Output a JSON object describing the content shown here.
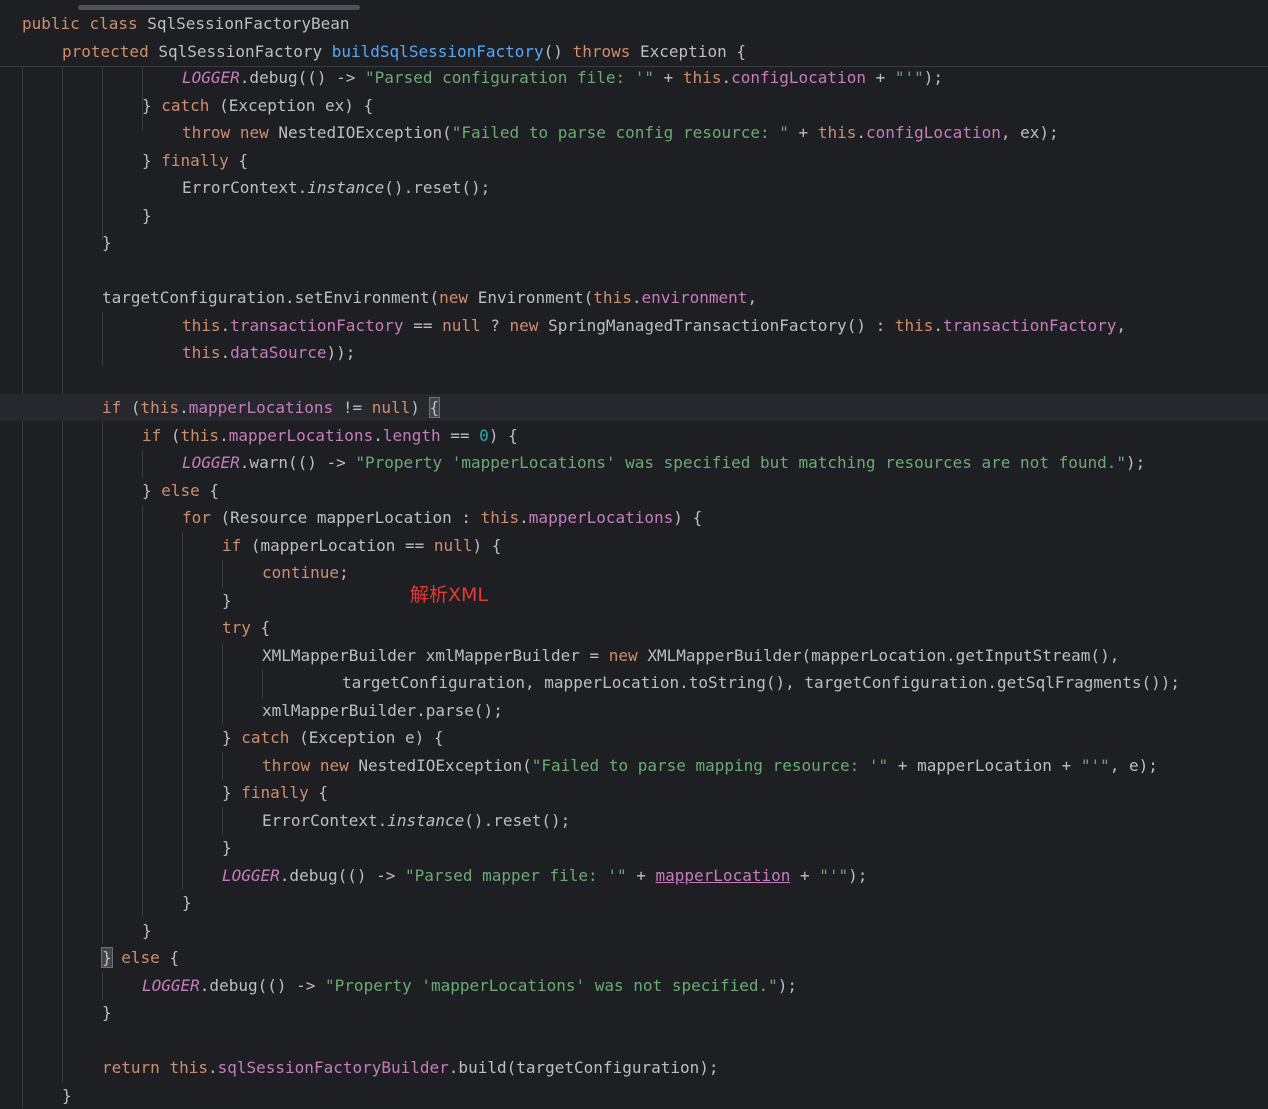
{
  "sticky_header": {
    "line1": [
      "public",
      "class",
      "SqlSessionFactoryBean"
    ],
    "line2": [
      "protected",
      "SqlSessionFactory",
      "buildSqlSessionFactory",
      "()",
      "throws",
      "Exception",
      "{"
    ]
  },
  "code": {
    "l1": [
      "LOGGER",
      ".debug(() -> ",
      "\"Parsed configuration file: '\"",
      " + ",
      "this",
      ".",
      "configLocation",
      " + ",
      "\"'\"",
      ");"
    ],
    "l2": [
      "} ",
      "catch",
      " (Exception ex) {"
    ],
    "l3": [
      "throw",
      " ",
      "new",
      " NestedIOException(",
      "\"Failed to parse config resource: \"",
      " + ",
      "this",
      ".",
      "configLocation",
      ", ex);"
    ],
    "l4": [
      "} ",
      "finally",
      " {"
    ],
    "l5": [
      "ErrorContext.",
      "instance",
      "().reset();"
    ],
    "l6": [
      "}"
    ],
    "l7": [
      "}"
    ],
    "l8": [
      "targetConfiguration.setEnvironment(",
      "new",
      " Environment(",
      "this",
      ".",
      "environment",
      ","
    ],
    "l9": [
      "this",
      ".",
      "transactionFactory",
      " == ",
      "null",
      " ? ",
      "new",
      " SpringManagedTransactionFactory() : ",
      "this",
      ".",
      "transactionFactory",
      ","
    ],
    "l10": [
      "this",
      ".",
      "dataSource",
      "));"
    ],
    "l11": [
      "if",
      " (",
      "this",
      ".",
      "mapperLocations",
      " != ",
      "null",
      ") ",
      "{"
    ],
    "l12": [
      "if",
      " (",
      "this",
      ".",
      "mapperLocations",
      ".",
      "length",
      " == ",
      "0",
      ") {"
    ],
    "l13": [
      "LOGGER",
      ".warn(() -> ",
      "\"Property 'mapperLocations' was specified but matching resources are not found.\"",
      ");"
    ],
    "l14": [
      "} ",
      "else",
      " {"
    ],
    "l15": [
      "for",
      " (Resource mapperLocation : ",
      "this",
      ".",
      "mapperLocations",
      ") {"
    ],
    "l16": [
      "if",
      " (mapperLocation == ",
      "null",
      ") {"
    ],
    "l17": [
      "continue",
      ";"
    ],
    "l18": [
      "}"
    ],
    "l19": [
      "try",
      " {"
    ],
    "l20": [
      "XMLMapperBuilder xmlMapperBuilder = ",
      "new",
      " XMLMapperBuilder(mapperLocation.getInputStream(),"
    ],
    "l21": [
      "targetConfiguration, mapperLocation.toString(), targetConfiguration.getSqlFragments());"
    ],
    "l22": [
      "xmlMapperBuilder.parse();"
    ],
    "l23": [
      "} ",
      "catch",
      " (Exception e) {"
    ],
    "l24": [
      "throw",
      " ",
      "new",
      " NestedIOException(",
      "\"Failed to parse mapping resource: '\"",
      " + mapperLocation + ",
      "\"'\"",
      ", e);"
    ],
    "l25": [
      "} ",
      "finally",
      " {"
    ],
    "l26": [
      "ErrorContext.",
      "instance",
      "().reset();"
    ],
    "l27": [
      "}"
    ],
    "l28": [
      "LOGGER",
      ".debug(() -> ",
      "\"Parsed mapper file: '\"",
      " + ",
      "mapperLocation",
      " + ",
      "\"'\"",
      ");"
    ],
    "l29": [
      "}"
    ],
    "l30": [
      "}"
    ],
    "l31": [
      "}",
      " ",
      "else",
      " {"
    ],
    "l32": [
      "LOGGER",
      ".debug(() -> ",
      "\"Property 'mapperLocations' was not specified.\"",
      ");"
    ],
    "l33": [
      "}"
    ],
    "l34": [
      "return",
      " ",
      "this",
      ".",
      "sqlSessionFactoryBuilder",
      ".build(targetConfiguration);"
    ],
    "l35": [
      "}"
    ]
  },
  "annotation": "解析XML",
  "colors": {
    "background": "#1e1f22",
    "keyword": "#cf8e6d",
    "field": "#c77dbb",
    "string": "#6aab73",
    "number": "#2aacb8",
    "method_decl": "#56a8f5",
    "default_text": "#bcbec4",
    "annotation": "#e53935"
  }
}
